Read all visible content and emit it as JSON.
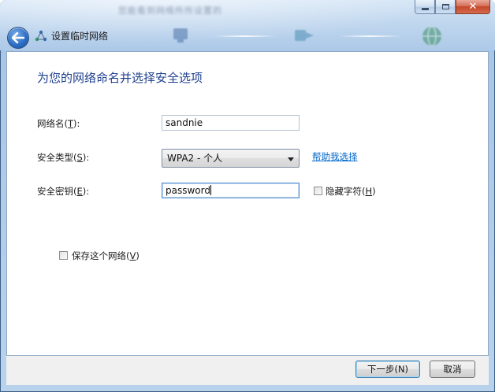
{
  "window": {
    "blurred_caption": "您能看到网络所所设置的",
    "nav_title": "设置临时网络"
  },
  "page": {
    "heading": "为您的网络命名并选择安全选项",
    "network_name_label": "网络名(",
    "network_name_key": "T",
    "network_name_label_end": "):",
    "network_name_value": "sandnie",
    "security_type_label": "安全类型(",
    "security_type_key": "S",
    "security_type_label_end": "):",
    "security_type_value": "WPA2 - 个人",
    "help_link": "帮助我选择",
    "security_key_label": "安全密钥(",
    "security_key_key": "E",
    "security_key_label_end": "):",
    "security_key_value": "password",
    "hide_chars_label": "隐藏字符(",
    "hide_chars_key": "H",
    "hide_chars_label_end": ")",
    "hide_chars_checked": false,
    "save_network_label": "保存这个网络(",
    "save_network_key": "V",
    "save_network_label_end": ")",
    "save_network_checked": false
  },
  "buttons": {
    "next_label": "下一步(N)",
    "cancel_label": "取消"
  },
  "colors": {
    "heading": "#1e3f8f",
    "link": "#0066cc",
    "close_button": "#c4472b"
  },
  "icons": {
    "back": "back-arrow-icon",
    "network": "adhoc-network-icon",
    "minimize": "minimize-icon",
    "maximize": "maximize-icon",
    "close": "close-icon"
  }
}
